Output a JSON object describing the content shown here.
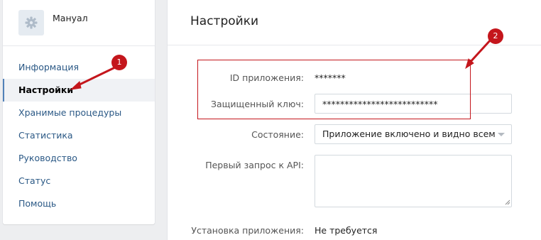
{
  "app": {
    "name": "Мануал",
    "icon": "gear-icon"
  },
  "sidebar": {
    "items": [
      {
        "label": "Информация",
        "active": false
      },
      {
        "label": "Настройки",
        "active": true
      },
      {
        "label": "Хранимые процедуры",
        "active": false
      },
      {
        "label": "Статистика",
        "active": false
      },
      {
        "label": "Руководство",
        "active": false
      },
      {
        "label": "Статус",
        "active": false
      },
      {
        "label": "Помощь",
        "active": false
      }
    ]
  },
  "page": {
    "title": "Настройки"
  },
  "settings": {
    "app_id": {
      "label": "ID приложения:",
      "value": "*******"
    },
    "secret_key": {
      "label": "Защищенный ключ:",
      "value": "**************************"
    },
    "state": {
      "label": "Состояние:",
      "value": "Приложение включено и видно всем"
    },
    "first_request": {
      "label": "Первый запрос к API:",
      "value": ""
    },
    "install": {
      "label": "Установка приложения:",
      "value": "Не требуется"
    }
  },
  "annotations": {
    "badge1": "1",
    "badge2": "2",
    "color": "#c4161c"
  },
  "colors": {
    "link": "#2a5885",
    "accent": "#5181b8",
    "background": "#edeef0"
  }
}
